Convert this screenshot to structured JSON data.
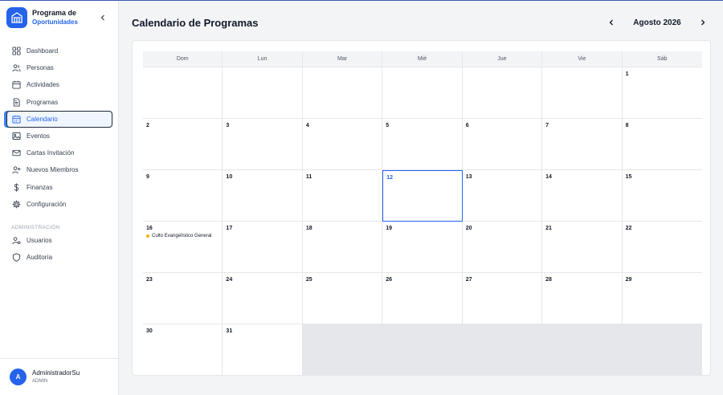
{
  "app": {
    "title": "Programa de",
    "subtitle": "Oportunidades",
    "logo_icon": "building-icon",
    "accent": "#2563eb"
  },
  "sidebar": {
    "items": [
      {
        "label": "Dashboard",
        "icon": "grid-icon"
      },
      {
        "label": "Personas",
        "icon": "people-icon"
      },
      {
        "label": "Actividades",
        "icon": "calendar-icon"
      },
      {
        "label": "Programas",
        "icon": "document-icon"
      },
      {
        "label": "Calendario",
        "icon": "calendar-icon",
        "active": true
      },
      {
        "label": "Eventos",
        "icon": "image-icon"
      },
      {
        "label": "Cartas Invitación",
        "icon": "mail-icon"
      },
      {
        "label": "Nuevos Miembros",
        "icon": "user-plus-icon"
      },
      {
        "label": "Finanzas",
        "icon": "dollar-icon"
      },
      {
        "label": "Configuración",
        "icon": "gear-icon"
      }
    ],
    "admin_section_label": "ADMINISTRACIÓN",
    "admin_items": [
      {
        "label": "Usuarios",
        "icon": "user-settings-icon"
      },
      {
        "label": "Auditoría",
        "icon": "shield-icon"
      }
    ]
  },
  "user": {
    "initial": "A",
    "name": "AdministradorSu",
    "role": "ADMIN"
  },
  "header": {
    "title": "Calendario de Programas",
    "month_label": "Agosto 2026"
  },
  "calendar": {
    "weekdays": [
      "Dom",
      "Lun",
      "Mar",
      "Mié",
      "Jue",
      "Vie",
      "Sáb"
    ],
    "cells": [
      {
        "day": ""
      },
      {
        "day": ""
      },
      {
        "day": ""
      },
      {
        "day": ""
      },
      {
        "day": ""
      },
      {
        "day": ""
      },
      {
        "day": "1"
      },
      {
        "day": "2"
      },
      {
        "day": "3"
      },
      {
        "day": "4"
      },
      {
        "day": "5"
      },
      {
        "day": "6"
      },
      {
        "day": "7"
      },
      {
        "day": "8"
      },
      {
        "day": "9"
      },
      {
        "day": "10"
      },
      {
        "day": "11"
      },
      {
        "day": "12",
        "today": true
      },
      {
        "day": "13"
      },
      {
        "day": "14"
      },
      {
        "day": "15"
      },
      {
        "day": "16",
        "events": [
          "Culto Evangelístico General"
        ]
      },
      {
        "day": "17"
      },
      {
        "day": "18"
      },
      {
        "day": "19"
      },
      {
        "day": "20"
      },
      {
        "day": "21"
      },
      {
        "day": "22"
      },
      {
        "day": "23"
      },
      {
        "day": "24"
      },
      {
        "day": "25"
      },
      {
        "day": "26"
      },
      {
        "day": "27"
      },
      {
        "day": "28"
      },
      {
        "day": "29"
      },
      {
        "day": "30"
      },
      {
        "day": "31"
      }
    ],
    "event_color": "#f5b700"
  }
}
